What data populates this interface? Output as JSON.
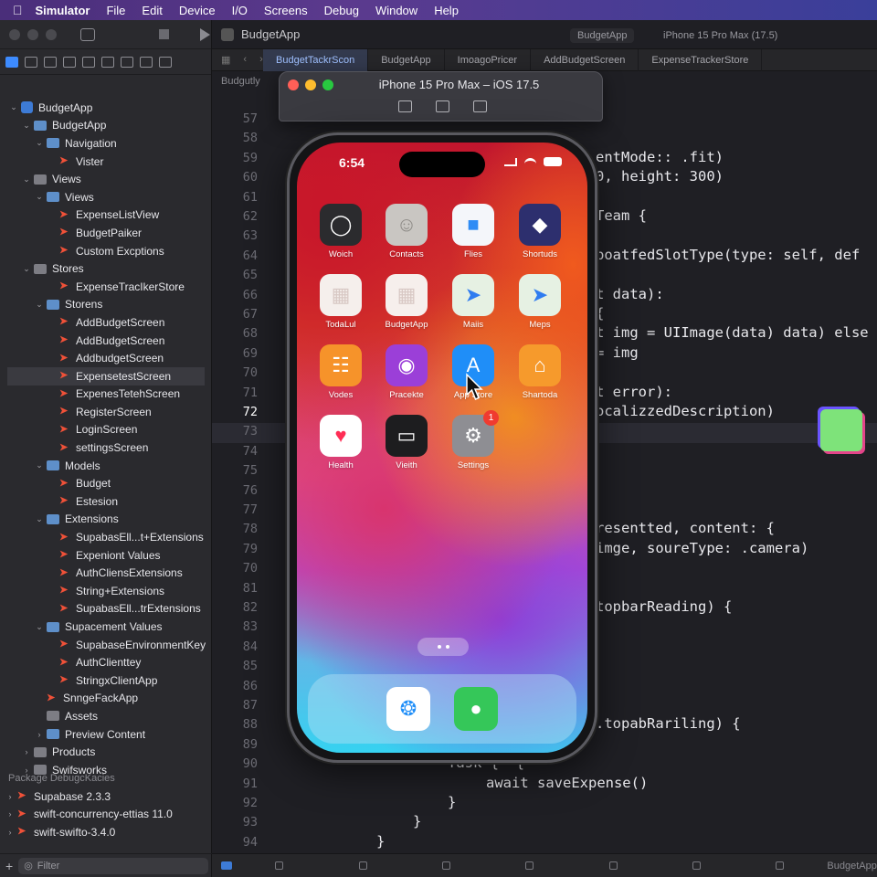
{
  "menubar": {
    "items": [
      "Simulator",
      "File",
      "Edit",
      "Device",
      "I/O",
      "Screens",
      "Debug",
      "Window",
      "Help"
    ]
  },
  "toolbar": {
    "project": "BudgetApp",
    "scheme": "BudgetApp",
    "destination": "iPhone 15 Pro Max (17.5)"
  },
  "tabs": [
    "BudgetTackrScon",
    "BudgetApp",
    "ImoagoPricer",
    "AddBudgetScreen",
    "ExpenseTrackerStore"
  ],
  "breadcrumb": "Budgutly",
  "navigator": [
    {
      "label": "BudgetApp",
      "depth": 0,
      "kind": "project",
      "open": true
    },
    {
      "label": "BudgetApp",
      "depth": 1,
      "kind": "folder",
      "open": true
    },
    {
      "label": "Navigation",
      "depth": 2,
      "kind": "folder",
      "open": true
    },
    {
      "label": "Vister",
      "depth": 3,
      "kind": "swift"
    },
    {
      "label": "Views",
      "depth": 1,
      "kind": "folder",
      "open": true
    },
    {
      "label": "Views",
      "depth": 2,
      "kind": "folder",
      "open": true
    },
    {
      "label": "ExpenseListView",
      "depth": 3,
      "kind": "swift"
    },
    {
      "label": "BudgetPaiker",
      "depth": 3,
      "kind": "swift"
    },
    {
      "label": "Custom Excptions",
      "depth": 3,
      "kind": "swift"
    },
    {
      "label": "Stores",
      "depth": 1,
      "kind": "folder",
      "open": true
    },
    {
      "label": "ExpenseTracIkerStore",
      "depth": 3,
      "kind": "swift"
    },
    {
      "label": "Storens",
      "depth": 2,
      "kind": "folder",
      "open": true
    },
    {
      "label": "AddBudgetScreen",
      "depth": 3,
      "kind": "swift"
    },
    {
      "label": "AddBudgetScreen",
      "depth": 3,
      "kind": "swift"
    },
    {
      "label": "AddbudgetScreen",
      "depth": 3,
      "kind": "swift"
    },
    {
      "label": "ExpensetestScreen",
      "depth": 3,
      "kind": "swift",
      "selected": true
    },
    {
      "label": "ExpenesTetehScreen",
      "depth": 3,
      "kind": "swift"
    },
    {
      "label": "RegisterScreen",
      "depth": 3,
      "kind": "swift"
    },
    {
      "label": "LoginScreen",
      "depth": 3,
      "kind": "swift"
    },
    {
      "label": "settingsScreen",
      "depth": 3,
      "kind": "swift"
    },
    {
      "label": "Models",
      "depth": 2,
      "kind": "folder",
      "open": true
    },
    {
      "label": "Budget",
      "depth": 3,
      "kind": "swift"
    },
    {
      "label": "Estesion",
      "depth": 3,
      "kind": "swift"
    },
    {
      "label": "Extensions",
      "depth": 2,
      "kind": "folder",
      "open": true
    },
    {
      "label": "SupabasEll...t+Extensions",
      "depth": 3,
      "kind": "swift"
    },
    {
      "label": "Expeniont Values",
      "depth": 3,
      "kind": "swift"
    },
    {
      "label": "AuthCliensExtensions",
      "depth": 3,
      "kind": "swift"
    },
    {
      "label": "String+Extensions",
      "depth": 3,
      "kind": "swift"
    },
    {
      "label": "SupabasEll...trExtensions",
      "depth": 3,
      "kind": "swift"
    },
    {
      "label": "Supacement Values",
      "depth": 2,
      "kind": "folder",
      "open": true
    },
    {
      "label": "SupabaseEnvironmentKey",
      "depth": 3,
      "kind": "swift"
    },
    {
      "label": "AuthClienttey",
      "depth": 3,
      "kind": "swift"
    },
    {
      "label": "StringxClientApp",
      "depth": 3,
      "kind": "swift"
    },
    {
      "label": "SnngeFackApp",
      "depth": 2,
      "kind": "swift"
    },
    {
      "label": "Assets",
      "depth": 2,
      "kind": "asset"
    },
    {
      "label": "Preview Content",
      "depth": 2,
      "kind": "folder",
      "open": false
    },
    {
      "label": "Products",
      "depth": 1,
      "kind": "folder",
      "open": false
    },
    {
      "label": "Swifsworks",
      "depth": 1,
      "kind": "folder",
      "open": false
    }
  ],
  "packages": {
    "header": "Package DebugcKacies",
    "items": [
      "Supabase 2.3.3",
      "swift-concurrency-ettias 11.0",
      "swift-swifto-3.4.0"
    ]
  },
  "filter": {
    "placeholder": "Filter"
  },
  "line_numbers": [
    "57",
    "58",
    "59",
    "60",
    "61",
    "62",
    "63",
    "64",
    "65",
    "66",
    "67",
    "68",
    "69",
    "70",
    "71",
    "72",
    "73",
    "74",
    "75",
    "76",
    "77",
    "78",
    "79",
    "70",
    "81",
    "82",
    "83",
    "84",
    "85",
    "86",
    "87",
    "88",
    "89",
    "90",
    "91",
    "92",
    "93",
    "94"
  ],
  "current_line": "72",
  "code": [
    {
      "line": "59",
      "text": "entMode:: .fit)"
    },
    {
      "line": "60",
      "text": "0, height: 300)"
    },
    {
      "line": "62",
      "text": "Team {"
    },
    {
      "line": "64",
      "text": "boatfedSlotType(type: self, def"
    },
    {
      "line": "66",
      "text": "t data):"
    },
    {
      "line": "67",
      "text": "{"
    },
    {
      "line": "68",
      "text": "t img = UIImage(data) data) else"
    },
    {
      "line": "69",
      "text": "= img"
    },
    {
      "line": "71",
      "text": "t error):"
    },
    {
      "line": "72",
      "text": "ocalizzedDescription)"
    },
    {
      "line": "78",
      "text": "resentted, content: {"
    },
    {
      "line": "79",
      "text": "imge, soureType: .camera)"
    },
    {
      "line": "82",
      "text": "topbarReading) {"
    },
    {
      "line": "88",
      "text": ".topabRariling) {"
    },
    {
      "line": "90",
      "text": "Task {  {"
    },
    {
      "line": "91",
      "text": "await saveExpense()"
    },
    {
      "line": "92",
      "text": "}"
    },
    {
      "line": "93",
      "text": "}"
    },
    {
      "line": "94",
      "text": "}"
    }
  ],
  "status_bar": {
    "target": "BudgetApp"
  },
  "simulator": {
    "title": "iPhone 15 Pro Max – iOS 17.5",
    "time": "6:54",
    "apps": [
      {
        "label": "Woich",
        "icon": "watch-icon",
        "bg": "#2b2b2e"
      },
      {
        "label": "Contacts",
        "icon": "contacts-icon",
        "bg": "#c9c6c2"
      },
      {
        "label": "Flies",
        "icon": "files-icon",
        "bg": "#f4f6fa"
      },
      {
        "label": "Shortuds",
        "icon": "shortcuts-icon",
        "bg": "#2d2f6e"
      },
      {
        "label": "TodaLul",
        "icon": "grid-icon",
        "bg": "#f5efec"
      },
      {
        "label": "BudgetApp",
        "icon": "grid-icon",
        "bg": "#f6efec"
      },
      {
        "label": "Maiis",
        "icon": "maps-icon",
        "bg": "#e6f1e3"
      },
      {
        "label": "Meps",
        "icon": "maps-icon",
        "bg": "#e6f1e3"
      },
      {
        "label": "Vodes",
        "icon": "books-icon",
        "bg": "#f6932a"
      },
      {
        "label": "Pracekte",
        "icon": "podcasts-icon",
        "bg": "#9b3fd8"
      },
      {
        "label": "App Store",
        "icon": "appstore-icon",
        "bg": "#1f8ef8"
      },
      {
        "label": "Shartoda",
        "icon": "home-icon",
        "bg": "#f69a2c"
      },
      {
        "label": "Health",
        "icon": "health-icon",
        "bg": "#ffffff"
      },
      {
        "label": "Vieith",
        "icon": "wallet-icon",
        "bg": "#1d1d1f"
      },
      {
        "label": "Settings",
        "icon": "settings-icon",
        "bg": "#8e8e93",
        "badge": "1"
      }
    ],
    "dock": [
      {
        "icon": "safari-icon",
        "bg": "#ffffff"
      },
      {
        "icon": "messages-icon",
        "bg": "#35c759"
      }
    ]
  }
}
